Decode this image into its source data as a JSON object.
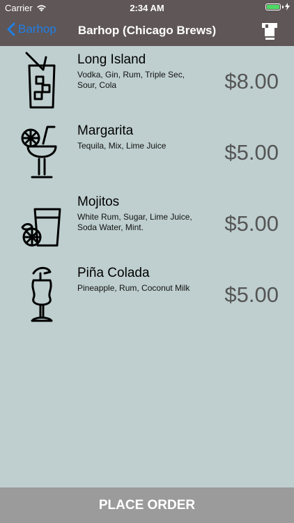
{
  "status_bar": {
    "carrier": "Carrier",
    "time": "2:34 AM",
    "wifi_icon": "wifi-icon",
    "battery_icon": "battery-charging-icon",
    "battery_color": "#4cd964"
  },
  "nav": {
    "back_label": "Barhop",
    "title": "Barhop (Chicago Brews)",
    "right_icon": "cup-icon",
    "bar_color": "#5f5657",
    "back_color": "#1f7fe6"
  },
  "drinks": [
    {
      "name": "Long Island",
      "description": "Vodka, Gin, Rum, Triple Sec, Sour, Cola",
      "price": "$8.00",
      "icon": "long-island-glass-icon"
    },
    {
      "name": "Margarita",
      "description": "Tequila, Mix, Lime Juice",
      "price": "$5.00",
      "icon": "margarita-glass-icon"
    },
    {
      "name": "Mojitos",
      "description": "White Rum, Sugar, Lime Juice, Soda Water, Mint.",
      "price": "$5.00",
      "icon": "mojito-glass-icon"
    },
    {
      "name": "Piña Colada",
      "description": "Pineapple, Rum, Coconut Milk",
      "price": "$5.00",
      "icon": "pina-colada-glass-icon"
    }
  ],
  "footer": {
    "button_label": "PLACE ORDER",
    "button_color": "#9b9b9b"
  },
  "background_color": "#bfcfcf"
}
